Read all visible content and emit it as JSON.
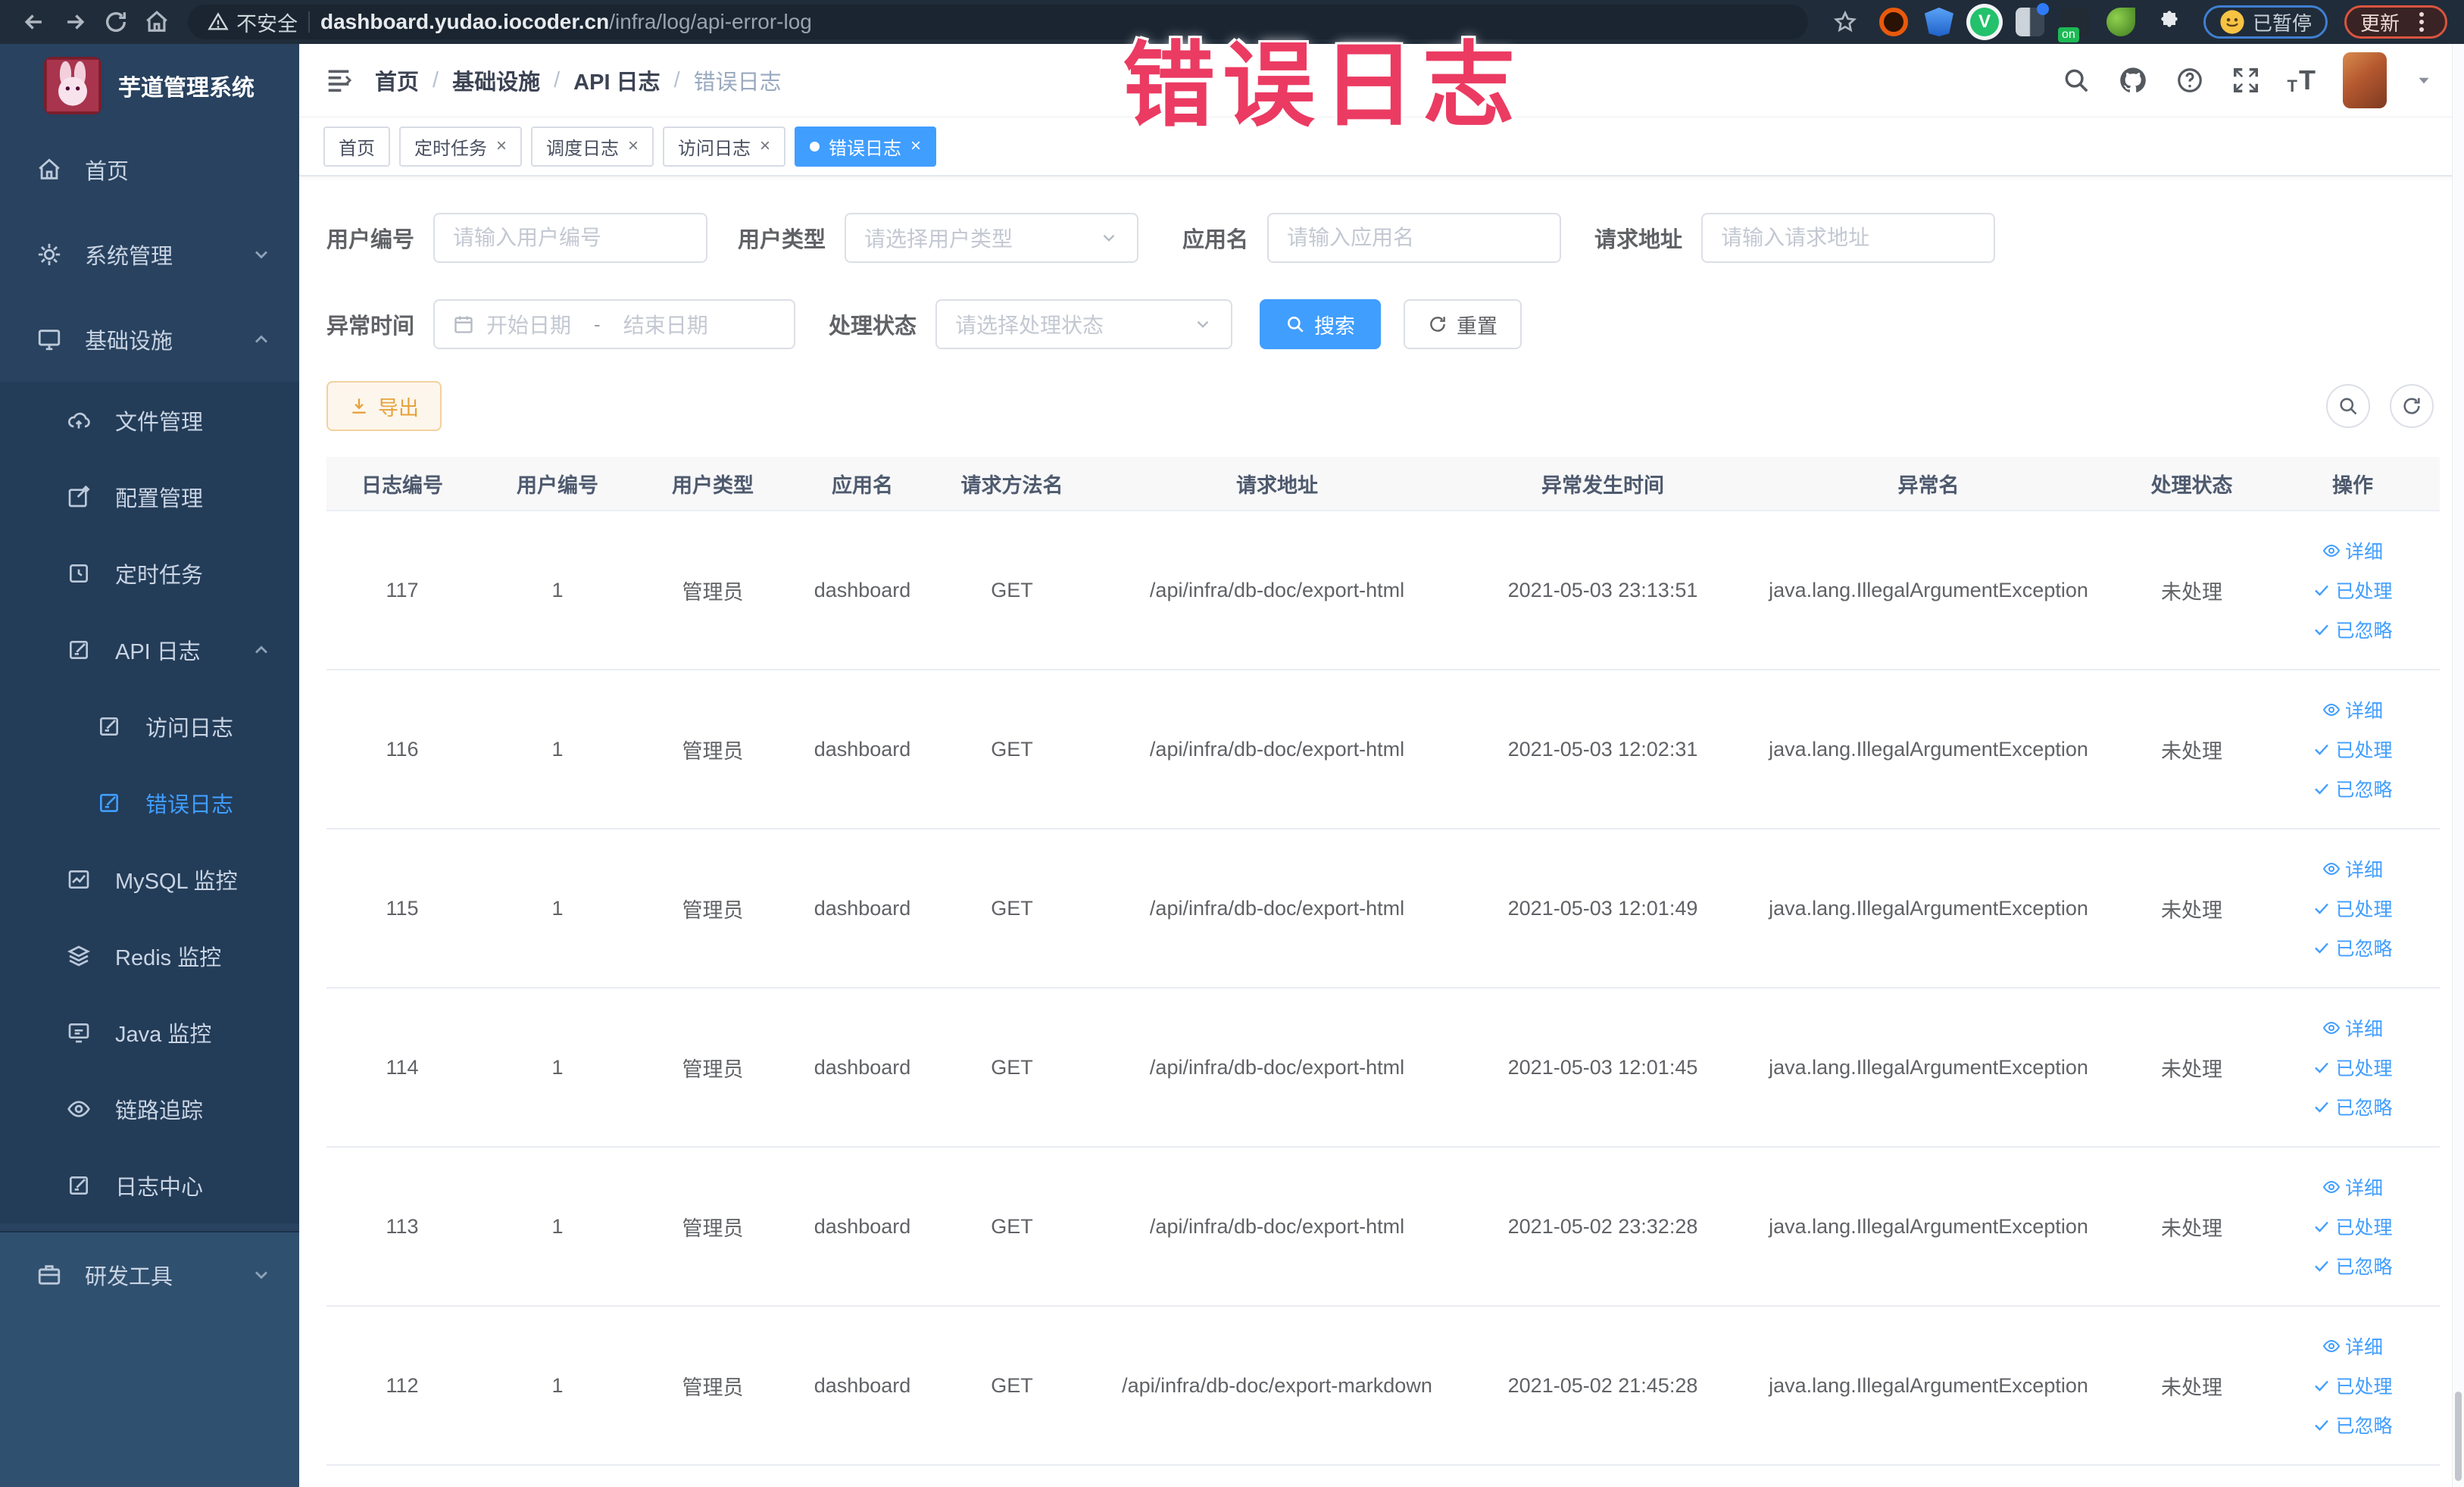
{
  "browser": {
    "security_warning": "不安全",
    "url_domain": "dashboard.yudao.iocoder.cn",
    "url_path": "/infra/log/api-error-log",
    "paused_badge": "已暂停",
    "update_button": "更新"
  },
  "annotation": {
    "text": "错误日志",
    "color": "#eb3b62"
  },
  "sidebar": {
    "title": "芋道管理系统",
    "items": [
      {
        "label": "首页"
      },
      {
        "label": "系统管理"
      },
      {
        "label": "基础设施"
      },
      {
        "label": "文件管理"
      },
      {
        "label": "配置管理"
      },
      {
        "label": "定时任务"
      },
      {
        "label": "API 日志"
      },
      {
        "label": "访问日志"
      },
      {
        "label": "错误日志"
      },
      {
        "label": "MySQL 监控"
      },
      {
        "label": "Redis 监控"
      },
      {
        "label": "Java 监控"
      },
      {
        "label": "链路追踪"
      },
      {
        "label": "日志中心"
      },
      {
        "label": "研发工具"
      }
    ]
  },
  "breadcrumb": [
    "首页",
    "基础设施",
    "API 日志",
    "错误日志"
  ],
  "tags": [
    {
      "label": "首页"
    },
    {
      "label": "定时任务"
    },
    {
      "label": "调度日志"
    },
    {
      "label": "访问日志"
    },
    {
      "label": "错误日志"
    }
  ],
  "filters": {
    "user_id": {
      "label": "用户编号",
      "placeholder": "请输入用户编号"
    },
    "user_type": {
      "label": "用户类型",
      "placeholder": "请选择用户类型"
    },
    "app_name": {
      "label": "应用名",
      "placeholder": "请输入应用名"
    },
    "request_url": {
      "label": "请求地址",
      "placeholder": "请输入请求地址"
    },
    "exception_time": {
      "label": "异常时间",
      "start_placeholder": "开始日期",
      "separator": "-",
      "end_placeholder": "结束日期"
    },
    "process_status": {
      "label": "处理状态",
      "placeholder": "请选择处理状态"
    },
    "search_button": "搜索",
    "reset_button": "重置"
  },
  "toolbar": {
    "export_button": "导出"
  },
  "table": {
    "columns": [
      "日志编号",
      "用户编号",
      "用户类型",
      "应用名",
      "请求方法名",
      "请求地址",
      "异常发生时间",
      "异常名",
      "处理状态",
      "操作"
    ],
    "action_labels": {
      "detail": "详细",
      "processed": "已处理",
      "ignored": "已忽略"
    },
    "rows": [
      {
        "id": "117",
        "user_id": "1",
        "user_type": "管理员",
        "app": "dashboard",
        "method": "GET",
        "url": "/api/infra/db-doc/export-html",
        "time": "2021-05-03 23:13:51",
        "exception": "java.lang.IllegalArgumentException",
        "status": "未处理"
      },
      {
        "id": "116",
        "user_id": "1",
        "user_type": "管理员",
        "app": "dashboard",
        "method": "GET",
        "url": "/api/infra/db-doc/export-html",
        "time": "2021-05-03 12:02:31",
        "exception": "java.lang.IllegalArgumentException",
        "status": "未处理"
      },
      {
        "id": "115",
        "user_id": "1",
        "user_type": "管理员",
        "app": "dashboard",
        "method": "GET",
        "url": "/api/infra/db-doc/export-html",
        "time": "2021-05-03 12:01:49",
        "exception": "java.lang.IllegalArgumentException",
        "status": "未处理"
      },
      {
        "id": "114",
        "user_id": "1",
        "user_type": "管理员",
        "app": "dashboard",
        "method": "GET",
        "url": "/api/infra/db-doc/export-html",
        "time": "2021-05-03 12:01:45",
        "exception": "java.lang.IllegalArgumentException",
        "status": "未处理"
      },
      {
        "id": "113",
        "user_id": "1",
        "user_type": "管理员",
        "app": "dashboard",
        "method": "GET",
        "url": "/api/infra/db-doc/export-html",
        "time": "2021-05-02 23:32:28",
        "exception": "java.lang.IllegalArgumentException",
        "status": "未处理"
      },
      {
        "id": "112",
        "user_id": "1",
        "user_type": "管理员",
        "app": "dashboard",
        "method": "GET",
        "url": "/api/infra/db-doc/export-markdown",
        "time": "2021-05-02 21:45:28",
        "exception": "java.lang.IllegalArgumentException",
        "status": "未处理"
      }
    ]
  }
}
